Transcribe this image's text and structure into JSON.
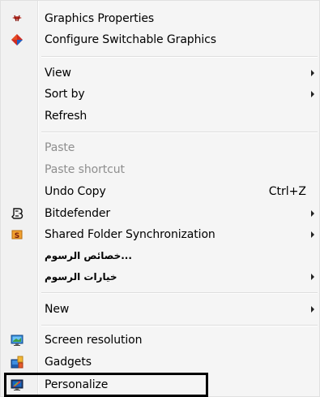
{
  "menu": {
    "graphics_properties": "Graphics Properties",
    "configure_switchable": "Configure Switchable Graphics",
    "view": "View",
    "sort_by": "Sort by",
    "refresh": "Refresh",
    "paste": "Paste",
    "paste_shortcut": "Paste shortcut",
    "undo_copy": "Undo Copy",
    "undo_shortcut": "Ctrl+Z",
    "bitdefender": "Bitdefender",
    "shared_folder_sync": "Shared Folder Synchronization",
    "graphics_properties_ar": "...خصائص الرسوم",
    "graphics_options_ar": "خيارات الرسوم",
    "new": "New",
    "screen_resolution": "Screen resolution",
    "gadgets": "Gadgets",
    "personalize": "Personalize"
  },
  "icons": {
    "graphics_properties": "intel-graphics-icon",
    "configure_switchable": "amd-switchable-icon",
    "bitdefender": "bitdefender-icon",
    "shared_folder_sync": "shared-folder-sync-icon",
    "screen_resolution": "monitor-icon",
    "gadgets": "gadgets-icon",
    "personalize": "personalize-icon"
  },
  "colors": {
    "disabled_text": "#8e8e8e",
    "highlight_border": "#000000"
  }
}
